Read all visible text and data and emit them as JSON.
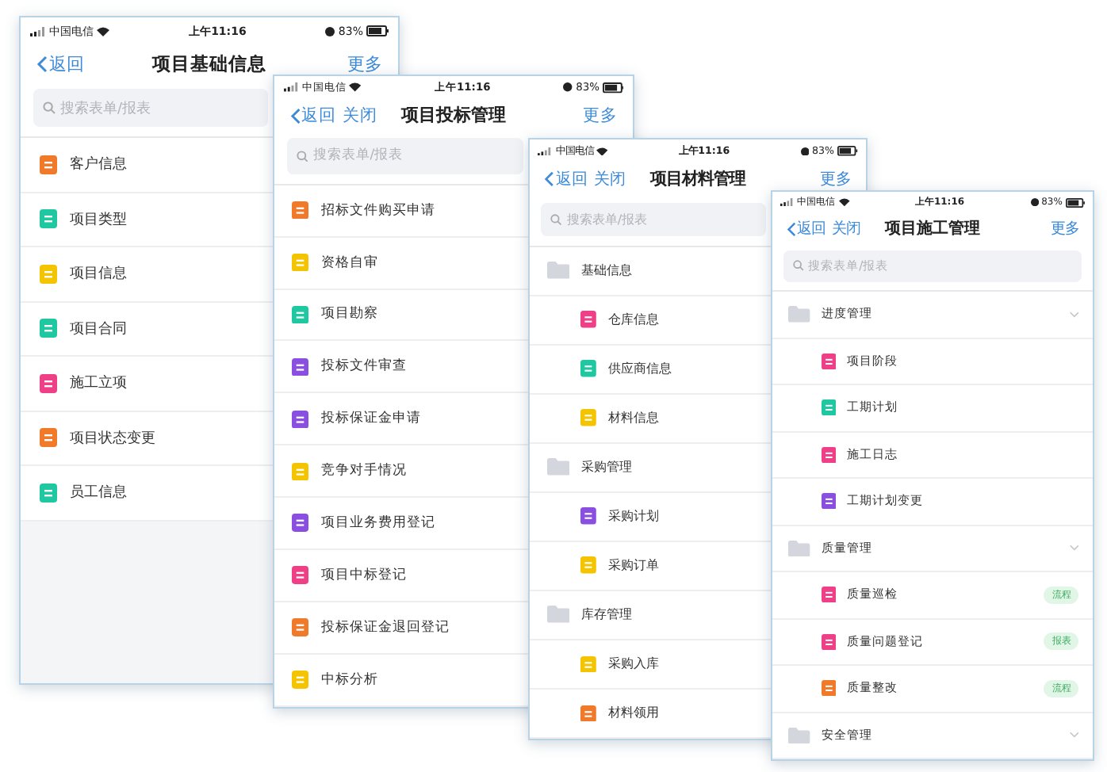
{
  "phones": [
    {
      "status": {
        "carrier": "中国电信",
        "time": "上午11:16",
        "battery": "83%"
      },
      "nav": {
        "back": "返回",
        "title": "项目基础信息",
        "more": "更多"
      },
      "search": {
        "placeholder": "搜索表单/报表"
      },
      "items": [
        {
          "kind": "item",
          "label": "客户信息",
          "color": "#f07a2a"
        },
        {
          "kind": "item",
          "label": "项目类型",
          "color": "#1fc8a0"
        },
        {
          "kind": "item",
          "label": "项目信息",
          "color": "#f5c400"
        },
        {
          "kind": "item",
          "label": "项目合同",
          "color": "#1fc8a0"
        },
        {
          "kind": "item",
          "label": "施工立项",
          "color": "#ef3f86"
        },
        {
          "kind": "item",
          "label": "项目状态变更",
          "color": "#f07a2a"
        },
        {
          "kind": "item",
          "label": "员工信息",
          "color": "#1fc8a0"
        }
      ]
    },
    {
      "status": {
        "carrier": "中国电信",
        "time": "上午11:16",
        "battery": "83%"
      },
      "nav": {
        "back": "返回",
        "close": "关闭",
        "title": "项目投标管理",
        "more": "更多"
      },
      "search": {
        "placeholder": "搜索表单/报表"
      },
      "items": [
        {
          "kind": "item",
          "label": "招标文件购买申请",
          "color": "#f07a2a"
        },
        {
          "kind": "item",
          "label": "资格自审",
          "color": "#f5c400"
        },
        {
          "kind": "item",
          "label": "项目勘察",
          "color": "#1fc8a0"
        },
        {
          "kind": "item",
          "label": "投标文件审查",
          "color": "#8a4fe0"
        },
        {
          "kind": "item",
          "label": "投标保证金申请",
          "color": "#8a4fe0"
        },
        {
          "kind": "item",
          "label": "竞争对手情况",
          "color": "#f5c400"
        },
        {
          "kind": "item",
          "label": "项目业务费用登记",
          "color": "#8a4fe0"
        },
        {
          "kind": "item",
          "label": "项目中标登记",
          "color": "#ef3f86"
        },
        {
          "kind": "item",
          "label": "投标保证金退回登记",
          "color": "#f07a2a"
        },
        {
          "kind": "item",
          "label": "中标分析",
          "color": "#f5c400"
        }
      ]
    },
    {
      "status": {
        "carrier": "中国电信",
        "time": "上午11:16",
        "battery": "83%"
      },
      "nav": {
        "back": "返回",
        "close": "关闭",
        "title": "项目材料管理",
        "more": "更多"
      },
      "search": {
        "placeholder": "搜索表单/报表"
      },
      "items": [
        {
          "kind": "group",
          "label": "基础信息"
        },
        {
          "kind": "item",
          "label": "仓库信息",
          "color": "#ef3f86"
        },
        {
          "kind": "item",
          "label": "供应商信息",
          "color": "#1fc8a0"
        },
        {
          "kind": "item",
          "label": "材料信息",
          "color": "#f5c400"
        },
        {
          "kind": "group",
          "label": "采购管理"
        },
        {
          "kind": "item",
          "label": "采购计划",
          "color": "#8a4fe0"
        },
        {
          "kind": "item",
          "label": "采购订单",
          "color": "#f5c400"
        },
        {
          "kind": "group",
          "label": "库存管理"
        },
        {
          "kind": "item",
          "label": "采购入库",
          "color": "#f5c400"
        },
        {
          "kind": "item",
          "label": "材料领用",
          "color": "#f07a2a"
        }
      ]
    },
    {
      "status": {
        "carrier": "中国电信",
        "time": "上午11:16",
        "battery": "83%"
      },
      "nav": {
        "back": "返回",
        "close": "关闭",
        "title": "项目施工管理",
        "more": "更多"
      },
      "search": {
        "placeholder": "搜索表单/报表"
      },
      "items": [
        {
          "kind": "group",
          "label": "进度管理",
          "expanded": true
        },
        {
          "kind": "item",
          "label": "项目阶段",
          "color": "#ef3f86"
        },
        {
          "kind": "item",
          "label": "工期计划",
          "color": "#1fc8a0"
        },
        {
          "kind": "item",
          "label": "施工日志",
          "color": "#ef3f86"
        },
        {
          "kind": "item",
          "label": "工期计划变更",
          "color": "#8a4fe0"
        },
        {
          "kind": "group",
          "label": "质量管理",
          "expanded": true
        },
        {
          "kind": "item",
          "label": "质量巡检",
          "color": "#ef3f86",
          "badge": "流程"
        },
        {
          "kind": "item",
          "label": "质量问题登记",
          "color": "#ef3f86",
          "badge": "报表"
        },
        {
          "kind": "item",
          "label": "质量整改",
          "color": "#f07a2a",
          "badge": "流程"
        },
        {
          "kind": "group",
          "label": "安全管理",
          "expanded": true
        }
      ]
    }
  ]
}
